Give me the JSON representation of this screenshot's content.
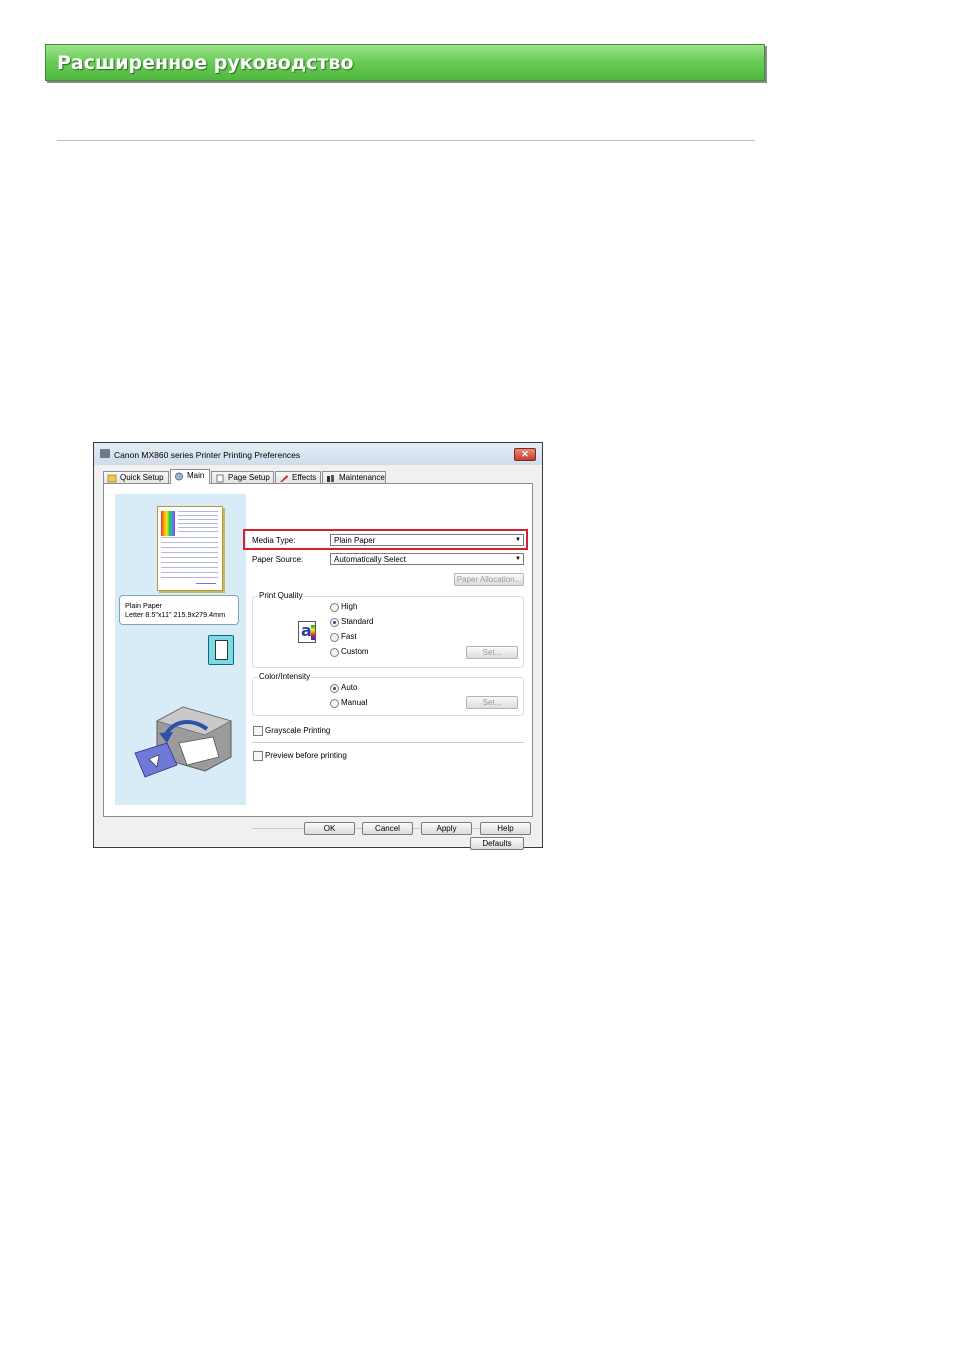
{
  "header": {
    "title": "Расширенное руководство"
  },
  "dialog": {
    "title": "Canon MX860 series Printer Printing Preferences",
    "close_glyph": "✕",
    "tabs": [
      {
        "label": "Quick Setup",
        "icon": "quick-setup-icon"
      },
      {
        "label": "Main",
        "icon": "main-icon",
        "active": true
      },
      {
        "label": "Page Setup",
        "icon": "page-setup-icon"
      },
      {
        "label": "Effects",
        "icon": "effects-icon"
      },
      {
        "label": "Maintenance",
        "icon": "maintenance-icon"
      }
    ],
    "preview": {
      "paper_line1": "Plain Paper",
      "paper_line2": "Letter 8.5\"x11\" 215.9x279.4mm"
    },
    "media_type": {
      "label": "Media Type:",
      "value": "Plain Paper"
    },
    "paper_source": {
      "label": "Paper Source:",
      "value": "Automatically Select"
    },
    "paper_allocation_button": "Paper Allocation...",
    "print_quality": {
      "title": "Print Quality",
      "options": [
        "High",
        "Standard",
        "Fast",
        "Custom"
      ],
      "selected": "Standard",
      "set_button": "Set..."
    },
    "color_intensity": {
      "title": "Color/Intensity",
      "options": [
        "Auto",
        "Manual"
      ],
      "selected": "Auto",
      "set_button": "Set..."
    },
    "grayscale": "Grayscale Printing",
    "preview_before": "Preview before printing",
    "defaults_button": "Defaults",
    "buttons": {
      "ok": "OK",
      "cancel": "Cancel",
      "apply": "Apply",
      "help": "Help"
    }
  },
  "colors": {
    "banner": "#6ccd5a",
    "highlight": "#d6202d",
    "preview_bg": "#d7ecf7"
  }
}
